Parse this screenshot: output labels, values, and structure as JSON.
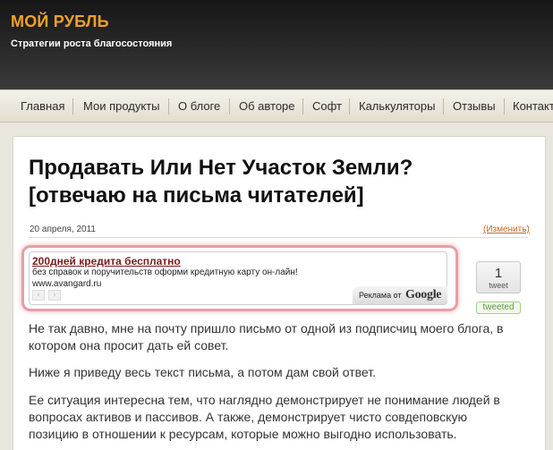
{
  "site": {
    "title": "МОЙ РУБЛЬ",
    "tagline": "Стратегии роста благосостояния"
  },
  "nav": {
    "items": [
      "Главная",
      "Мои продукты",
      "О блоге",
      "Об авторе",
      "Софт",
      "Калькуляторы",
      "Отзывы",
      "Контакты"
    ]
  },
  "post": {
    "title_line1": "Продавать Или Нет Участок Земли?",
    "title_line2": "[отвечаю на письма читателей]",
    "date": "20 апреля, 2011",
    "edit_label": "(Изменить)",
    "paragraphs": [
      "Не так давно, мне на почту пришло письмо от одной из подписчиц моего блога, в котором она просит дать ей совет.",
      "Ниже я приведу весь текст письма, а потом дам свой ответ.",
      "Ее ситуация интересна тем, что наглядно демонстрирует не понимание людей в вопросах активов и пассивов. А также, демонстрирует чисто совдеповскую позицию в отношении к ресурсам, которые можно выгодно использовать."
    ]
  },
  "ad": {
    "title": "200дней кредита бесплатно",
    "text": "без справок и поручительств оформи кредитную карту он-лайн!",
    "url": "www.avangard.ru",
    "prev": "‹",
    "next": "›",
    "label": "Реклама от",
    "brand": "Google"
  },
  "tweet": {
    "count": "1",
    "label": "tweet",
    "tweeted": "tweeted"
  },
  "colors": {
    "brand_orange": "#f1a12a",
    "ad_highlight": "#e4a0a8",
    "tweeted_green": "#5a9a3a"
  }
}
